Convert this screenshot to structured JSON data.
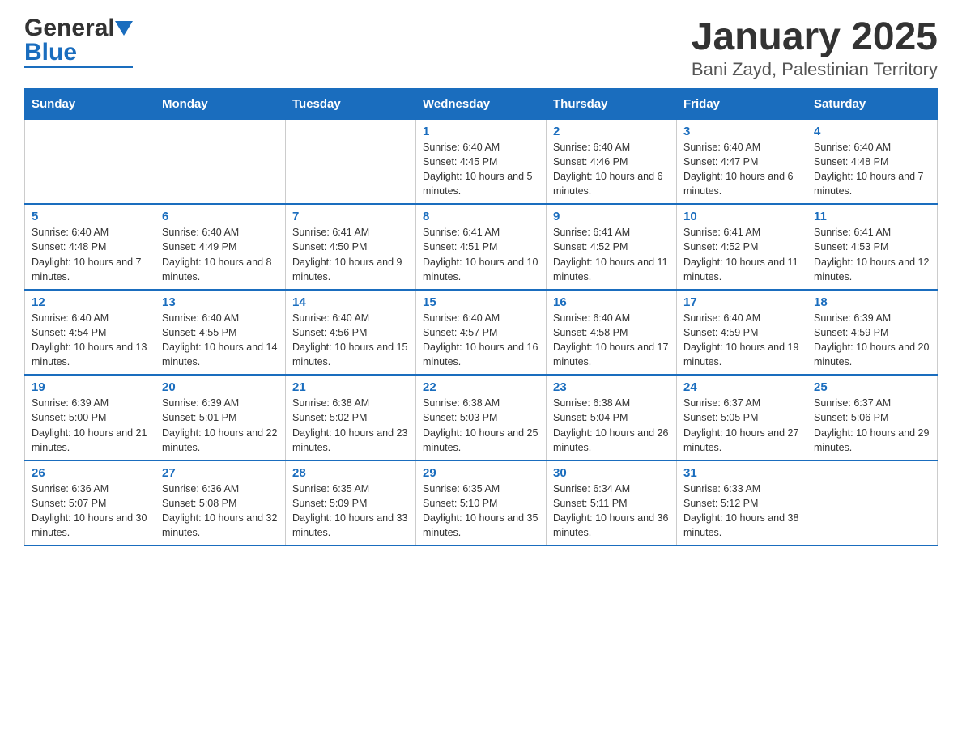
{
  "header": {
    "logo_general": "General",
    "logo_blue": "Blue",
    "title": "January 2025",
    "subtitle": "Bani Zayd, Palestinian Territory"
  },
  "calendar": {
    "days_of_week": [
      "Sunday",
      "Monday",
      "Tuesday",
      "Wednesday",
      "Thursday",
      "Friday",
      "Saturday"
    ],
    "weeks": [
      [
        {
          "day": "",
          "info": ""
        },
        {
          "day": "",
          "info": ""
        },
        {
          "day": "",
          "info": ""
        },
        {
          "day": "1",
          "info": "Sunrise: 6:40 AM\nSunset: 4:45 PM\nDaylight: 10 hours and 5 minutes."
        },
        {
          "day": "2",
          "info": "Sunrise: 6:40 AM\nSunset: 4:46 PM\nDaylight: 10 hours and 6 minutes."
        },
        {
          "day": "3",
          "info": "Sunrise: 6:40 AM\nSunset: 4:47 PM\nDaylight: 10 hours and 6 minutes."
        },
        {
          "day": "4",
          "info": "Sunrise: 6:40 AM\nSunset: 4:48 PM\nDaylight: 10 hours and 7 minutes."
        }
      ],
      [
        {
          "day": "5",
          "info": "Sunrise: 6:40 AM\nSunset: 4:48 PM\nDaylight: 10 hours and 7 minutes."
        },
        {
          "day": "6",
          "info": "Sunrise: 6:40 AM\nSunset: 4:49 PM\nDaylight: 10 hours and 8 minutes."
        },
        {
          "day": "7",
          "info": "Sunrise: 6:41 AM\nSunset: 4:50 PM\nDaylight: 10 hours and 9 minutes."
        },
        {
          "day": "8",
          "info": "Sunrise: 6:41 AM\nSunset: 4:51 PM\nDaylight: 10 hours and 10 minutes."
        },
        {
          "day": "9",
          "info": "Sunrise: 6:41 AM\nSunset: 4:52 PM\nDaylight: 10 hours and 11 minutes."
        },
        {
          "day": "10",
          "info": "Sunrise: 6:41 AM\nSunset: 4:52 PM\nDaylight: 10 hours and 11 minutes."
        },
        {
          "day": "11",
          "info": "Sunrise: 6:41 AM\nSunset: 4:53 PM\nDaylight: 10 hours and 12 minutes."
        }
      ],
      [
        {
          "day": "12",
          "info": "Sunrise: 6:40 AM\nSunset: 4:54 PM\nDaylight: 10 hours and 13 minutes."
        },
        {
          "day": "13",
          "info": "Sunrise: 6:40 AM\nSunset: 4:55 PM\nDaylight: 10 hours and 14 minutes."
        },
        {
          "day": "14",
          "info": "Sunrise: 6:40 AM\nSunset: 4:56 PM\nDaylight: 10 hours and 15 minutes."
        },
        {
          "day": "15",
          "info": "Sunrise: 6:40 AM\nSunset: 4:57 PM\nDaylight: 10 hours and 16 minutes."
        },
        {
          "day": "16",
          "info": "Sunrise: 6:40 AM\nSunset: 4:58 PM\nDaylight: 10 hours and 17 minutes."
        },
        {
          "day": "17",
          "info": "Sunrise: 6:40 AM\nSunset: 4:59 PM\nDaylight: 10 hours and 19 minutes."
        },
        {
          "day": "18",
          "info": "Sunrise: 6:39 AM\nSunset: 4:59 PM\nDaylight: 10 hours and 20 minutes."
        }
      ],
      [
        {
          "day": "19",
          "info": "Sunrise: 6:39 AM\nSunset: 5:00 PM\nDaylight: 10 hours and 21 minutes."
        },
        {
          "day": "20",
          "info": "Sunrise: 6:39 AM\nSunset: 5:01 PM\nDaylight: 10 hours and 22 minutes."
        },
        {
          "day": "21",
          "info": "Sunrise: 6:38 AM\nSunset: 5:02 PM\nDaylight: 10 hours and 23 minutes."
        },
        {
          "day": "22",
          "info": "Sunrise: 6:38 AM\nSunset: 5:03 PM\nDaylight: 10 hours and 25 minutes."
        },
        {
          "day": "23",
          "info": "Sunrise: 6:38 AM\nSunset: 5:04 PM\nDaylight: 10 hours and 26 minutes."
        },
        {
          "day": "24",
          "info": "Sunrise: 6:37 AM\nSunset: 5:05 PM\nDaylight: 10 hours and 27 minutes."
        },
        {
          "day": "25",
          "info": "Sunrise: 6:37 AM\nSunset: 5:06 PM\nDaylight: 10 hours and 29 minutes."
        }
      ],
      [
        {
          "day": "26",
          "info": "Sunrise: 6:36 AM\nSunset: 5:07 PM\nDaylight: 10 hours and 30 minutes."
        },
        {
          "day": "27",
          "info": "Sunrise: 6:36 AM\nSunset: 5:08 PM\nDaylight: 10 hours and 32 minutes."
        },
        {
          "day": "28",
          "info": "Sunrise: 6:35 AM\nSunset: 5:09 PM\nDaylight: 10 hours and 33 minutes."
        },
        {
          "day": "29",
          "info": "Sunrise: 6:35 AM\nSunset: 5:10 PM\nDaylight: 10 hours and 35 minutes."
        },
        {
          "day": "30",
          "info": "Sunrise: 6:34 AM\nSunset: 5:11 PM\nDaylight: 10 hours and 36 minutes."
        },
        {
          "day": "31",
          "info": "Sunrise: 6:33 AM\nSunset: 5:12 PM\nDaylight: 10 hours and 38 minutes."
        },
        {
          "day": "",
          "info": ""
        }
      ]
    ]
  }
}
